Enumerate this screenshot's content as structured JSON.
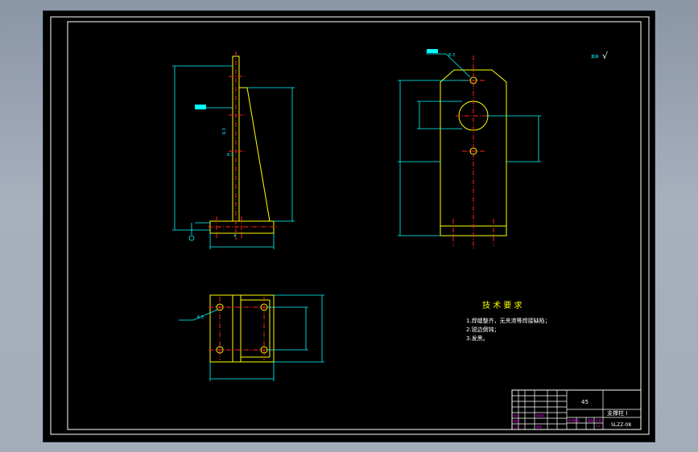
{
  "colors": {
    "background": "#000000",
    "frame": "#ffffff",
    "part_outline": "#ffff00",
    "dimension": "#00ffff",
    "centerline": "#ff2020",
    "table_text": "#ff00ff"
  },
  "annotations": {
    "roughness_note": "其余",
    "roughness_mark": "√",
    "roughness_value": "6.3",
    "weld_mark": "4"
  },
  "tech_requirements": {
    "title": "技 术 要 求",
    "items": [
      "1.焊缝整齐，无夹渣等焊接缺陷；",
      "2.锐边倒钝；",
      "3.发黑。"
    ]
  },
  "title_block": {
    "material": "45",
    "part_name": "支撑柱 I",
    "drawing_no": "SLZZ-08",
    "cells_left": [
      "标记",
      "处数",
      "分区",
      "更改文件号",
      "签名",
      "年月日",
      "设计",
      "标准化",
      "审核",
      "工艺",
      "批准"
    ],
    "cells_mid": [
      "阶段标记",
      "重量",
      "比例",
      "1:2"
    ]
  }
}
